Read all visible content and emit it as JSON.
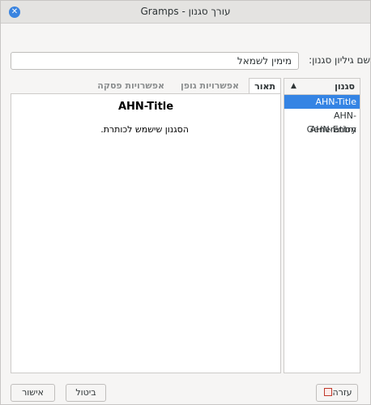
{
  "window": {
    "title": "עורך סגנון - Gramps",
    "close_icon": "close-icon"
  },
  "style_sheet": {
    "label": "שם גיליון סגנון:",
    "value": "מימין לשמאל"
  },
  "tabs": [
    {
      "label": "תאור",
      "active": true
    },
    {
      "label": "אפשרויות גופן",
      "active": false
    },
    {
      "label": "אפשרויות פסקה",
      "active": false
    }
  ],
  "preview": {
    "title": "AHN-Title",
    "description": "הסגנון שישמש לכותרת."
  },
  "style_list": {
    "header": "סגנון",
    "sort_icon": "sort-ascending-icon",
    "items": [
      "AHN-Title",
      "AHN-Generation",
      "AHN-Entry"
    ],
    "selected_index": 0
  },
  "buttons": {
    "help": "עזרה",
    "cancel": "ביטול",
    "ok": "אישור"
  }
}
